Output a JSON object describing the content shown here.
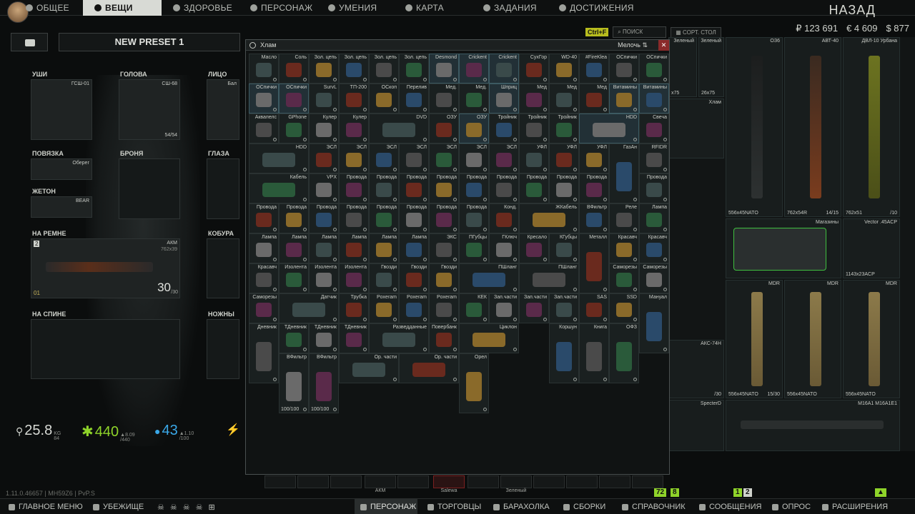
{
  "topnav": {
    "items": [
      {
        "label": "ОБЩЕЕ",
        "icon": "gear-icon"
      },
      {
        "label": "ВЕЩИ",
        "icon": "gear-icon"
      },
      {
        "label": "ЗДОРОВЬЕ",
        "icon": "health-icon"
      },
      {
        "label": "ПЕРСОНАЖ",
        "icon": "person-icon"
      },
      {
        "label": "УМЕНИЯ",
        "icon": "skills-icon"
      },
      {
        "label": "КАРТА",
        "icon": "map-icon"
      },
      {
        "label": "ЗАДАНИЯ",
        "icon": "tasks-icon"
      },
      {
        "label": "ДОСТИЖЕНИЯ",
        "icon": "achievements-icon"
      }
    ],
    "back": "НАЗАД"
  },
  "currency": {
    "rub": "₽ 123 691",
    "eur": "€ 4 609",
    "usd": "$ 877"
  },
  "tools": {
    "hint": "Ctrl+F",
    "search": "ПОИСК",
    "sort": "СОРТ. СТОЛ"
  },
  "preset": {
    "name": "NEW PRESET 1"
  },
  "slots": {
    "ears": {
      "label": "УШИ",
      "item": "ГСШ-01"
    },
    "head": {
      "label": "ГОЛОВА",
      "item": "СШ-68",
      "dur": "54/54"
    },
    "face": {
      "label": "ЛИЦО",
      "item": "Бал"
    },
    "armband": {
      "label": "ПОВЯЗКА",
      "item": "Оберег"
    },
    "armor": {
      "label": "БРОНЯ"
    },
    "eyes": {
      "label": "ГЛАЗА"
    },
    "tag": {
      "label": "ЖЕТОН",
      "item": "BEAR"
    },
    "belt": {
      "label": "НА РЕМНЕ",
      "item": "АКМ",
      "caliber": "762x39",
      "ammo": "30",
      "ammo_max": "/30",
      "num": "2",
      "mark": "01"
    },
    "holster": {
      "label": "КОБУРА"
    },
    "back": {
      "label": "НА СПИНЕ"
    },
    "knives": {
      "label": "НОЖНЫ"
    }
  },
  "stats": {
    "weight": "25.8",
    "weight_max": "84",
    "weight_unit": "KG",
    "energy": "440",
    "energy_max": "/440",
    "energy_rate": "▲8.09",
    "hydration": "43",
    "hydration_max": "/100",
    "hydration_rate": "▲1.10"
  },
  "junk": {
    "title": "Хлам",
    "sort": "Мелочь",
    "close": "✕",
    "cells": [
      {
        "n": "Масло"
      },
      {
        "n": "Соль"
      },
      {
        "n": "Зол. цепь"
      },
      {
        "n": "Зол. цепь"
      },
      {
        "n": "Зол. цепь"
      },
      {
        "n": "Зол. цепь"
      },
      {
        "n": "Desmond"
      },
      {
        "n": "Crickent"
      },
      {
        "n": "Crickent"
      },
      {
        "n": "СухГор"
      },
      {
        "n": "WD-40"
      },
      {
        "n": "#FireKlea"
      },
      {
        "n": "ОСпички"
      },
      {
        "n": "ОСпички"
      },
      {
        "n": "ОСпички"
      },
      {
        "n": "ОСпички"
      },
      {
        "n": "SurvL"
      },
      {
        "n": "ТП-200"
      },
      {
        "n": "ОСкоп"
      },
      {
        "n": "Перелив"
      },
      {
        "n": "Мед."
      },
      {
        "n": "Мед."
      },
      {
        "n": "Шприц"
      },
      {
        "n": "Мед"
      },
      {
        "n": "Мед"
      },
      {
        "n": "Мед"
      },
      {
        "n": "Витамины"
      },
      {
        "n": "Витамины"
      },
      {
        "n": "Аквапелс"
      },
      {
        "n": "GPhone"
      },
      {
        "n": "Кулер"
      },
      {
        "n": "Кулер"
      },
      {
        "n": "DVD"
      },
      {
        "n": "ОЗУ"
      },
      {
        "n": "ОЗУ"
      },
      {
        "n": "Тройник"
      },
      {
        "n": "Тройник"
      },
      {
        "n": "Тройник"
      },
      {
        "n": "HDD"
      },
      {
        "n": "Свеча"
      },
      {
        "n": "HDD"
      },
      {
        "n": "ЭСЛ"
      },
      {
        "n": "ЭСЛ"
      },
      {
        "n": "ЭСЛ"
      },
      {
        "n": "ЭСЛ"
      },
      {
        "n": "ЭСЛ"
      },
      {
        "n": "ЭСЛ"
      },
      {
        "n": "ЭСЛ"
      },
      {
        "n": "УФЛ"
      },
      {
        "n": "УФЛ"
      },
      {
        "n": "УФЛ"
      },
      {
        "n": "ГазАн"
      },
      {
        "n": "RFIDR"
      },
      {
        "n": "Кабель"
      },
      {
        "n": "VPX"
      },
      {
        "n": "Провода"
      },
      {
        "n": "Провода"
      },
      {
        "n": "Провода"
      },
      {
        "n": "Провода"
      },
      {
        "n": "Провода"
      },
      {
        "n": "Провода"
      },
      {
        "n": "Провода"
      },
      {
        "n": "Провода"
      },
      {
        "n": "Провода"
      },
      {
        "n": "Провода"
      },
      {
        "n": "Провода"
      },
      {
        "n": "Провода"
      },
      {
        "n": "Провода"
      },
      {
        "n": "Провода"
      },
      {
        "n": "Провода"
      },
      {
        "n": "Провода"
      },
      {
        "n": "Провода"
      },
      {
        "n": "Провода"
      },
      {
        "n": "Конд."
      },
      {
        "n": "ЖКабель"
      },
      {
        "n": "ВФильтр"
      },
      {
        "n": "Реле"
      },
      {
        "n": "Лампа"
      },
      {
        "n": "Лампа"
      },
      {
        "n": "Лампа"
      },
      {
        "n": "Лампа"
      },
      {
        "n": "Лампа"
      },
      {
        "n": "Лампа"
      },
      {
        "n": "Лампа"
      },
      {
        "n": "ЭКС"
      },
      {
        "n": "ПГубцы"
      },
      {
        "n": "ГКлюч"
      },
      {
        "n": "Кресало"
      },
      {
        "n": "КГубцы"
      },
      {
        "n": "Металл"
      },
      {
        "n": "Красавч"
      },
      {
        "n": "Красавч"
      },
      {
        "n": "Красавч"
      },
      {
        "n": "Изолента"
      },
      {
        "n": "Изолента"
      },
      {
        "n": "Изолента"
      },
      {
        "n": "Гвозди"
      },
      {
        "n": "Гвозди"
      },
      {
        "n": "Гвозди"
      },
      {
        "n": "ПШланг"
      },
      {
        "n": "ПШланг"
      },
      {
        "n": "Саморезы"
      },
      {
        "n": "Саморезы"
      },
      {
        "n": "Саморезы"
      },
      {
        "n": "Датчик"
      },
      {
        "n": "Трубка"
      },
      {
        "n": "Poxeram"
      },
      {
        "n": "Poxeram"
      },
      {
        "n": "Poxeram"
      },
      {
        "n": "КЕК"
      },
      {
        "n": "Зап.части"
      },
      {
        "n": "Зап.части"
      },
      {
        "n": "Зап.части"
      },
      {
        "n": "SAS"
      },
      {
        "n": "SSD"
      },
      {
        "n": "Мануал"
      },
      {
        "n": "Дневник"
      },
      {
        "n": "ТДневник"
      },
      {
        "n": "ТДневник"
      },
      {
        "n": "ТДневник"
      },
      {
        "n": "Разведданные"
      },
      {
        "n": "Повербанк"
      },
      {
        "n": "Циклон"
      },
      {
        "n": "Коршун"
      },
      {
        "n": "Книга"
      },
      {
        "n": "ОФЗ"
      },
      {
        "n": "ВФильтр",
        "d": "100/100"
      },
      {
        "n": "ВФильтр",
        "d": "100/100"
      },
      {
        "n": "Ор. части"
      },
      {
        "n": "Ор. части"
      },
      {
        "n": "Орел"
      }
    ]
  },
  "stash": {
    "cells": [
      {
        "n": "Зеленый",
        "s": "х75"
      },
      {
        "n": "Зеленый",
        "s": "26x75"
      },
      {
        "n": "ОЗ6"
      },
      {
        "n": "АВТ-40"
      },
      {
        "n": "ДВЛ-10 Урбана"
      },
      {
        "n": "Хлам"
      },
      {
        "n": "Магазины"
      },
      {
        "n": "Vector .45ACP"
      },
      {
        "n": "MDR"
      },
      {
        "n": "MDR"
      },
      {
        "n": "MDR"
      },
      {
        "n": "АКС-74Н"
      },
      {
        "n": "SpecterD"
      },
      {
        "n": "M16A1 M16A1E1"
      }
    ],
    "labels": {
      "a": "556x45NATO",
      "b": "762x54R",
      "c": "14/15",
      "d": "762x51",
      "e": "/10",
      "f": "1143x23ACP",
      "g": "/30",
      "h": "556x45NATO",
      "i": "15/30",
      "j": "556x45NATO",
      "k": "556x45NATO"
    }
  },
  "quickslots": {
    "labels": [
      "АКМ",
      "Salewa",
      "Зеленый"
    ]
  },
  "version": "1.11.0.46657 | MH59Z6 | PvP.S",
  "badges": {
    "a": "72",
    "b": "8",
    "c": "1",
    "d": "2"
  },
  "bottombar": {
    "items": [
      {
        "label": "ГЛАВНОЕ МЕНЮ"
      },
      {
        "label": "УБЕЖИЩЕ"
      },
      {
        "label": "ПЕРСОНАЖ"
      },
      {
        "label": "ТОРГОВЦЫ"
      },
      {
        "label": "БАРАХОЛКА"
      },
      {
        "label": "СБОРКИ"
      },
      {
        "label": "СПРАВОЧНИК"
      },
      {
        "label": "СООБЩЕНИЯ"
      },
      {
        "label": "ОПРОС"
      },
      {
        "label": "РАСШИРЕНИЯ"
      }
    ]
  },
  "colors": {
    "accent": "#d8dad5",
    "energy": "#8fd42a",
    "hydration": "#3aa8e8",
    "highlight": "#b8bd1e"
  }
}
